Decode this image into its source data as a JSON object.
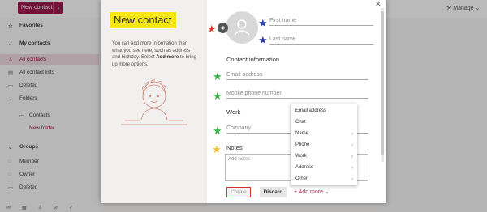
{
  "app": {
    "new_contact_button": "New contact",
    "manage": "Manage"
  },
  "sidebar": {
    "items": [
      {
        "label": "Favorites",
        "icon": "☆"
      },
      {
        "label": "My contacts",
        "icon": "⌄"
      },
      {
        "label": "All contacts",
        "icon": "👤"
      },
      {
        "label": "All contact lists",
        "icon": "▤"
      },
      {
        "label": "Deleted",
        "icon": "🗑"
      },
      {
        "label": "Folders",
        "icon": "⌄"
      },
      {
        "label": "Contacts"
      },
      {
        "label": "New folder"
      },
      {
        "label": "Groups",
        "icon": "⌄"
      },
      {
        "label": "Member",
        "icon": "◌"
      },
      {
        "label": "Owner",
        "icon": "◌"
      },
      {
        "label": "Deleted",
        "icon": "🗑"
      }
    ]
  },
  "modal": {
    "title": "New contact",
    "description_part1": "You can add more information than what you see here, such as address and birthday. Select ",
    "description_bold": "Add more",
    "description_part2": " to bring up more options.",
    "first_name": "First name",
    "last_name": "Last name",
    "contact_info_heading": "Contact information",
    "email": "Email address",
    "mobile": "Mobile phone number",
    "work_heading": "Work",
    "company": "Company",
    "notes_heading": "Notes",
    "notes_placeholder": "Add notes",
    "create_label": "Create",
    "discard_label": "Discard",
    "add_more_label": "Add more",
    "close_icon": "✕"
  },
  "add_more_menu": [
    "Email address",
    "Chat",
    "Name",
    "Phone",
    "Work",
    "Address",
    "Other"
  ],
  "colors": {
    "brand": "#9a1a4a",
    "title_highlight": "#f5e614",
    "create_outline": "#d8322d",
    "star_red": "#d93a2a",
    "star_blue": "#2a3fb0",
    "star_green": "#3ab34a",
    "star_yellow": "#f2c230"
  }
}
